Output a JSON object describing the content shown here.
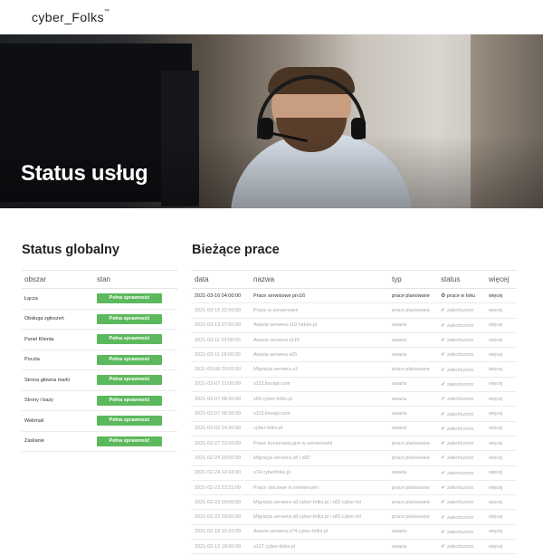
{
  "brand": {
    "logo_text": "cyber_Folks",
    "logo_mark": "™"
  },
  "hero": {
    "title": "Status usług"
  },
  "global": {
    "title": "Status globalny",
    "col_area": "obszar",
    "col_state": "stan",
    "rows": [
      {
        "area": "Łącza",
        "state": "Pełna sprawność"
      },
      {
        "area": "Obsługa zgłoszeń",
        "state": "Pełna sprawność"
      },
      {
        "area": "Panel Klienta",
        "state": "Pełna sprawność"
      },
      {
        "area": "Poczta",
        "state": "Pełna sprawność"
      },
      {
        "area": "Strona główna marki",
        "state": "Pełna sprawność"
      },
      {
        "area": "Strony i bazy",
        "state": "Pełna sprawność"
      },
      {
        "area": "Webmail",
        "state": "Pełna sprawność"
      },
      {
        "area": "Zasilanie",
        "state": "Pełna sprawność"
      }
    ],
    "badge_color": "#5cb85c"
  },
  "current": {
    "title": "Bieżące prace",
    "col_date": "data",
    "col_name": "nazwa",
    "col_type": "typ",
    "col_status": "status",
    "col_more": "więcej",
    "rows": [
      {
        "date": "2021-03-16 04:00:00",
        "name": "Prace serwisowe pro16",
        "type": "prace planowane",
        "status": "prace w toku",
        "more": "więcej",
        "active": true
      },
      {
        "date": "2021-03-15 22:00:00",
        "name": "Prace w serwerowni",
        "type": "prace planowane",
        "status": "zakończono",
        "more": "więcej"
      },
      {
        "date": "2021-03-13 07:00:00",
        "name": "Awaria serwera s10.hekko.pl",
        "type": "awaria",
        "status": "zakończono",
        "more": "więcej"
      },
      {
        "date": "2021-03-11 23:00:00",
        "name": "Awaria serwera s115",
        "type": "awaria",
        "status": "zakończono",
        "more": "więcej"
      },
      {
        "date": "2021-03-11 19:00:00",
        "name": "Awaria serwera s65",
        "type": "awaria",
        "status": "zakończono",
        "more": "więcej"
      },
      {
        "date": "2021-03-08 20:00:00",
        "name": "Migracja serwera s2",
        "type": "prace planowane",
        "status": "zakończono",
        "more": "więcej"
      },
      {
        "date": "2021-03-07 21:00:00",
        "name": "s115.linuxpl.com",
        "type": "awaria",
        "status": "zakończono",
        "more": "więcej"
      },
      {
        "date": "2021-03-07 08:30:00",
        "name": "s69.cyber-folks.pl",
        "type": "awaria",
        "status": "zakończono",
        "more": "więcej"
      },
      {
        "date": "2021-03-07 08:30:00",
        "name": "s115.linuxpl.com",
        "type": "awaria",
        "status": "zakończono",
        "more": "więcej"
      },
      {
        "date": "2021-03-02 14:30:00",
        "name": "cyber-folks.pl",
        "type": "awaria",
        "status": "zakończono",
        "more": "więcej"
      },
      {
        "date": "2021-02-27 22:00:00",
        "name": "Prace konserwacyjne w serwerowni",
        "type": "prace planowane",
        "status": "zakończono",
        "more": "więcej"
      },
      {
        "date": "2021-02-24 20:00:00",
        "name": "Migracja serwera s8 i s82",
        "type": "prace planowane",
        "status": "zakończono",
        "more": "więcej"
      },
      {
        "date": "2021-02-24 12:43:00",
        "name": "s74.cyberfolks.pl",
        "type": "awaria",
        "status": "zakończono",
        "more": "więcej"
      },
      {
        "date": "2021-02-23 23:31:00",
        "name": "Prace sieciowe w serwerowni",
        "type": "prace planowane",
        "status": "zakończono",
        "more": "więcej"
      },
      {
        "date": "2021-02-23 20:00:00",
        "name": "Migracja serwera s8.cyber-folks.pl i s82.cyber-fol",
        "type": "prace planowane",
        "status": "zakończono",
        "more": "więcej"
      },
      {
        "date": "2021-02-22 20:00:00",
        "name": "Migracja serwera s8.cyber-folks.pl i s82.cyber-fol",
        "type": "prace planowane",
        "status": "zakończono",
        "more": "więcej"
      },
      {
        "date": "2021-02-18 15:10:00",
        "name": "Awaria serwera s74.cyber-folks.pl",
        "type": "awaria",
        "status": "zakończono",
        "more": "więcej"
      },
      {
        "date": "2021-02-12 18:00:00",
        "name": "s127.cyber-folks.pl",
        "type": "awaria",
        "status": "zakończono",
        "more": "więcej"
      },
      {
        "date": "2021-02-10 19:00:00",
        "name": "Migracja serwera s93",
        "type": "awaria",
        "status": "zakończono",
        "more": "więcej"
      }
    ]
  }
}
